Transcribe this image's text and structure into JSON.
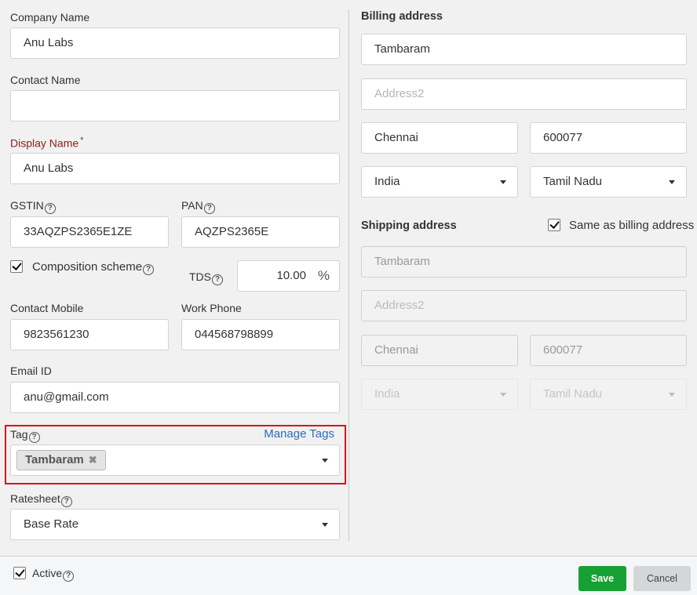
{
  "left": {
    "company_name": {
      "label": "Company Name",
      "value": "Anu Labs"
    },
    "contact_name": {
      "label": "Contact Name",
      "value": ""
    },
    "display_name": {
      "label": "Display Name",
      "required_mark": "*",
      "value": "Anu Labs"
    },
    "gstin": {
      "label": "GSTIN",
      "value": "33AQZPS2365E1ZE"
    },
    "pan": {
      "label": "PAN",
      "value": "AQZPS2365E"
    },
    "composition_scheme": {
      "label": "Composition scheme",
      "checked": true
    },
    "tds": {
      "label": "TDS",
      "value": "10.00",
      "unit": "%"
    },
    "contact_mobile": {
      "label": "Contact Mobile",
      "value": "9823561230"
    },
    "work_phone": {
      "label": "Work Phone",
      "value": "044568798899"
    },
    "email": {
      "label": "Email ID",
      "value": "anu@gmail.com"
    },
    "tag": {
      "label": "Tag",
      "manage_link": "Manage Tags",
      "chips": [
        "Tambaram"
      ],
      "chip_remove_glyph": "✖"
    },
    "ratesheet": {
      "label": "Ratesheet",
      "value": "Base Rate"
    },
    "help_glyph": "?"
  },
  "billing": {
    "title": "Billing address",
    "address1": "Tambaram",
    "address2_placeholder": "Address2",
    "city": "Chennai",
    "pincode": "600077",
    "country": "India",
    "state": "Tamil Nadu"
  },
  "shipping": {
    "title": "Shipping address",
    "same_as_billing": {
      "label": "Same as billing address",
      "checked": true
    },
    "address1": "Tambaram",
    "address2_placeholder": "Address2",
    "city": "Chennai",
    "pincode": "600077",
    "country": "India",
    "state": "Tamil Nadu"
  },
  "footer": {
    "active": {
      "label": "Active",
      "checked": true
    },
    "save_label": "Save",
    "cancel_label": "Cancel"
  },
  "colors": {
    "save": "#17a034",
    "link": "#2a6db5",
    "required": "#8b1c1c",
    "highlight": "#d9141a"
  }
}
